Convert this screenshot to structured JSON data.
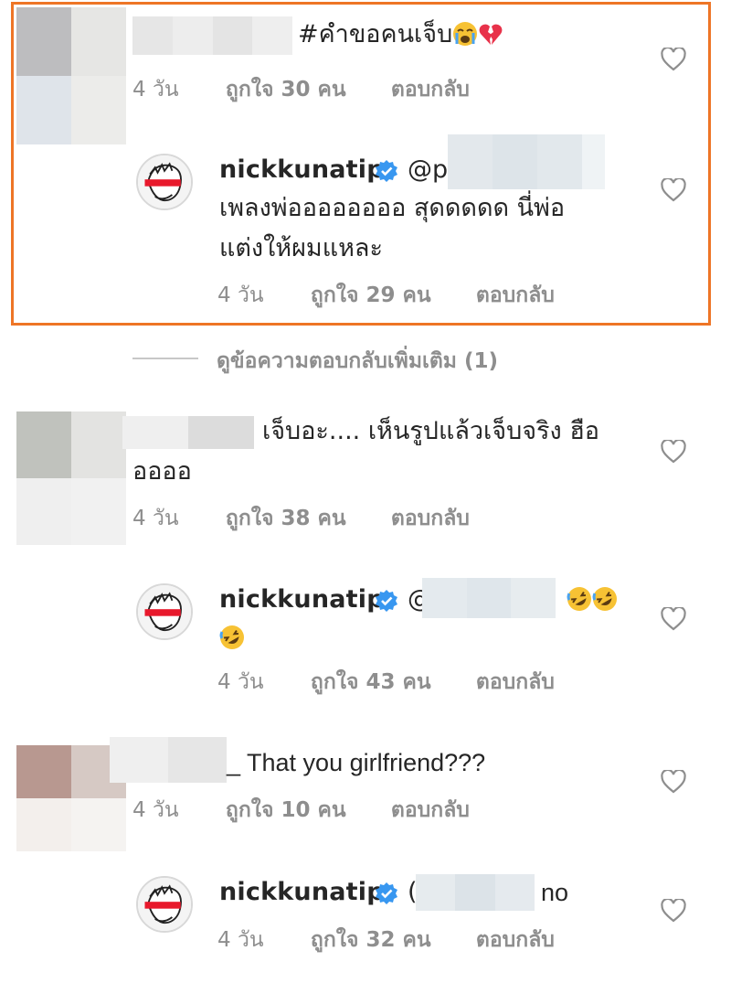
{
  "colors": {
    "highlight_border": "#ee7526",
    "username": "#262626",
    "meta_text": "#8e8e8e",
    "verified_badge": "#3897f0"
  },
  "comments": [
    {
      "text": "#คำขอคนเจ็บ",
      "emojis": [
        "crying-face-emoji",
        "broken-heart-emoji"
      ],
      "time": "4 วัน",
      "likes": "ถูกใจ 30 คน",
      "reply": "ตอบกลับ"
    },
    {
      "username": "nickkunatip",
      "mention": "@p",
      "text_line1": "เพลงพ่ออออออออ สุดดดดด นี่พ่อ",
      "text_line2": "แต่งให้ผมแหละ",
      "time": "4 วัน",
      "likes": "ถูกใจ 29 คน",
      "reply": "ตอบกลับ"
    },
    {
      "view_more": "ดูข้อความตอบกลับเพิ่มเติม (1)"
    },
    {
      "text_line1": "เจ็บอะ.... เห็นรูปแล้วเจ็บจริง ฮือ",
      "text_line2": "ออออ",
      "time": "4 วัน",
      "likes": "ถูกใจ 38 คน",
      "reply": "ตอบกลับ"
    },
    {
      "username": "nickkunatip",
      "mention": "@",
      "emojis": [
        "rofl-emoji",
        "rofl-emoji",
        "rofl-emoji"
      ],
      "time": "4 วัน",
      "likes": "ถูกใจ 43 คน",
      "reply": "ตอบกลับ"
    },
    {
      "text": "_ That you girlfriend???",
      "time": "4 วัน",
      "likes": "ถูกใจ 10 คน",
      "reply": "ตอบกลับ"
    },
    {
      "username": "nickkunatip",
      "mention": "(",
      "text": "no",
      "time": "4 วัน",
      "likes": "ถูกใจ 32 คน",
      "reply": "ตอบกลับ"
    }
  ]
}
